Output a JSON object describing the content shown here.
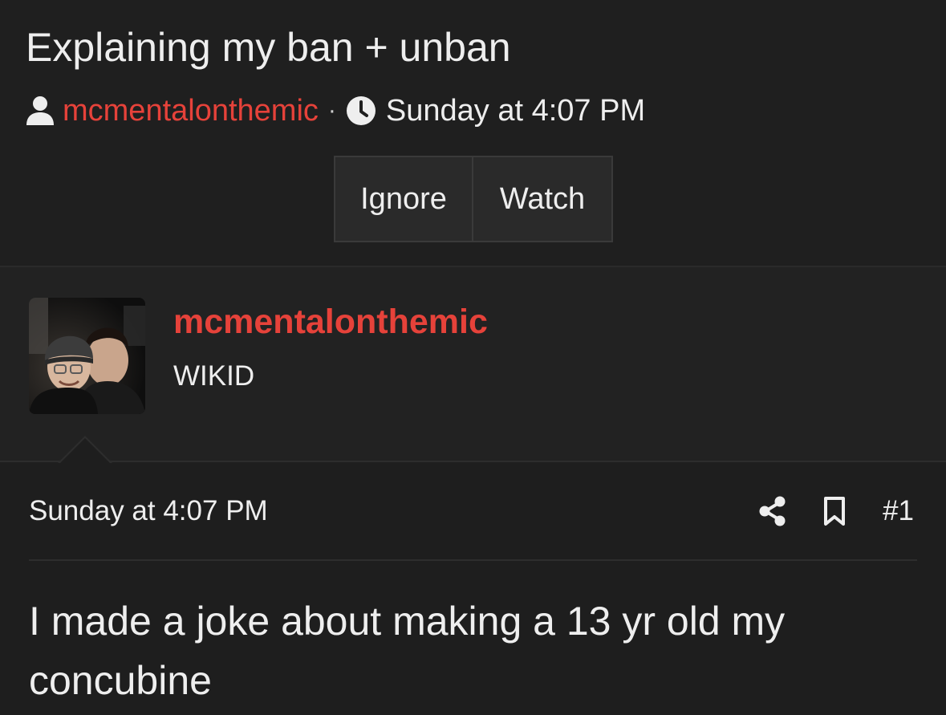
{
  "thread": {
    "title": "Explaining my ban + unban",
    "author": "mcmentalonthemic",
    "separator": "·",
    "time": "Sunday at 4:07 PM"
  },
  "actions": {
    "ignore_label": "Ignore",
    "watch_label": "Watch"
  },
  "user": {
    "name": "mcmentalonthemic",
    "title": "WIKID",
    "avatar_icon": "user-photo-avatar"
  },
  "post": {
    "date": "Sunday at 4:07 PM",
    "number": "#1",
    "body": "I made a joke about making a 13 yr old my concubine",
    "share_icon": "share-icon",
    "bookmark_icon": "bookmark-icon"
  },
  "colors": {
    "accent": "#e6423a",
    "background": "#1e1e1e",
    "text": "#eeeeee"
  }
}
